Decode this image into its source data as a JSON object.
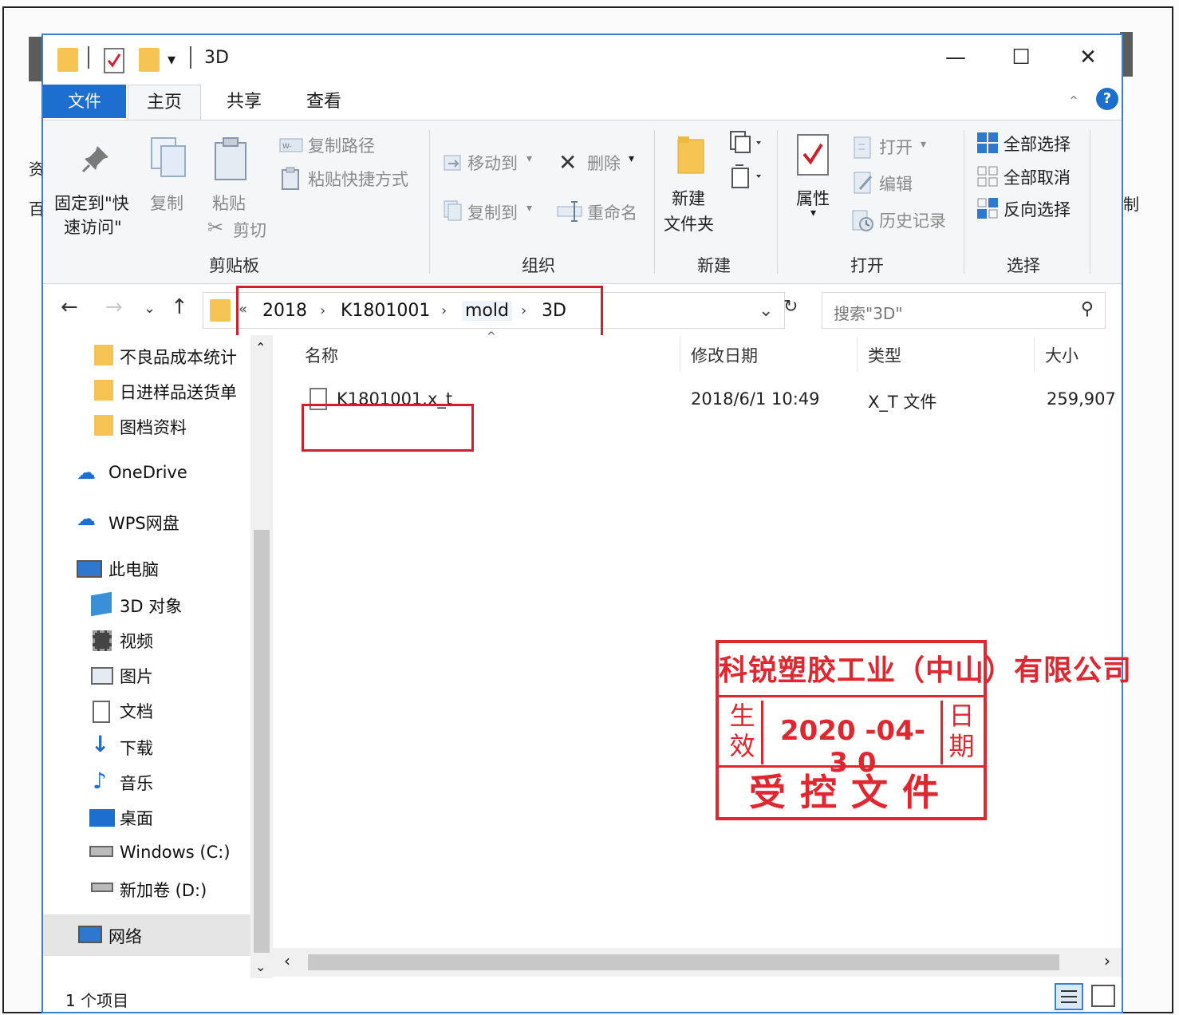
{
  "window": {
    "title": "3D",
    "minimize": "—",
    "maximize": "☐",
    "close": "✕"
  },
  "ribbon_tabs": [
    "文件",
    "主页",
    "共享",
    "查看"
  ],
  "clipboard": {
    "pin_line1": "固定到\"快",
    "pin_line2": "速访问\"",
    "copy": "复制",
    "paste": "粘贴",
    "copy_path": "复制路径",
    "paste_shortcut": "粘贴快捷方式",
    "cut": "剪切",
    "group": "剪贴板"
  },
  "organize": {
    "move_to": "移动到",
    "copy_to": "复制到",
    "delete": "删除",
    "rename": "重命名",
    "group": "组织"
  },
  "new": {
    "new_folder_line1": "新建",
    "new_folder_line2": "文件夹",
    "group": "新建"
  },
  "open": {
    "properties": "属性",
    "open": "打开",
    "edit": "编辑",
    "history": "历史记录",
    "group": "打开"
  },
  "select": {
    "select_all": "全部选择",
    "select_none": "全部取消",
    "invert": "反向选择",
    "group": "选择"
  },
  "address": {
    "overflow": "«",
    "crumbs": [
      "2018",
      "K1801001",
      "mold",
      "3D"
    ],
    "search_placeholder": "搜索\"3D\""
  },
  "nav": {
    "quick": [
      "不良品成本统计",
      "日进样品送货单",
      "图档资料"
    ],
    "onedrive": "OneDrive",
    "wps": "WPS网盘",
    "thispc": "此电脑",
    "pc_items": [
      "3D 对象",
      "视频",
      "图片",
      "文档",
      "下载",
      "音乐",
      "桌面",
      "Windows (C:)",
      "新加卷 (D:)"
    ],
    "network": "网络"
  },
  "columns": {
    "name": "名称",
    "date": "修改日期",
    "type": "类型",
    "size": "大小"
  },
  "files": [
    {
      "name": "K1801001.x_t",
      "date": "2018/6/1 10:49",
      "type": "X_T 文件",
      "size": "259,907"
    }
  ],
  "status": {
    "count": "1 个项目"
  },
  "stamp": {
    "company": "科锐塑胶工业（中山）有限公司",
    "left": "生效",
    "right": "日期",
    "date": "2020 -04- 3 0",
    "bottom": "受控文件"
  },
  "colors": {
    "accent": "#1c6fcf",
    "highlight_box": "#d0202e",
    "stamp": "#e0262f",
    "folder": "#f5c452"
  }
}
